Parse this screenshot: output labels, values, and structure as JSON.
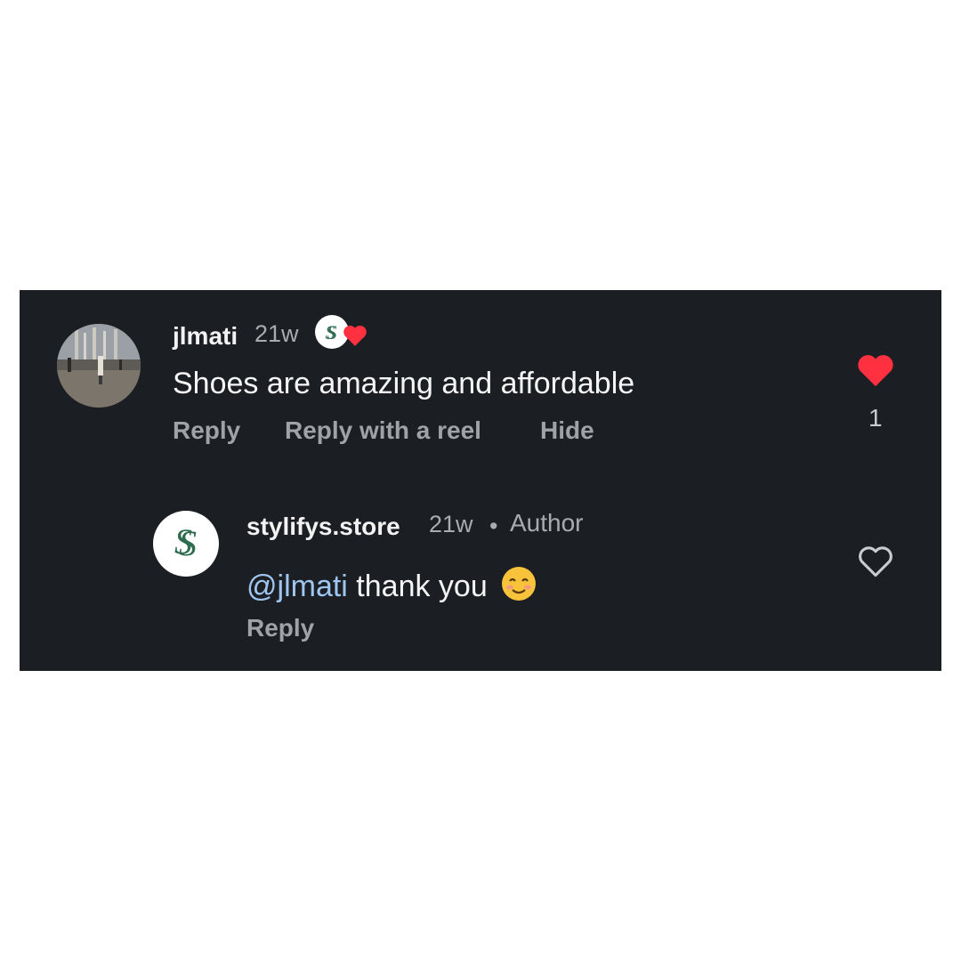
{
  "comment": {
    "username": "jlmati",
    "time": "21w",
    "text": "Shoes are amazing and affordable",
    "actions": {
      "reply": "Reply",
      "reply_reel": "Reply with a reel",
      "hide": "Hide"
    },
    "like_count": "1",
    "liked": true,
    "liked_by_author_icon": "heart-icon"
  },
  "reply": {
    "username": "stylifys.store",
    "time": "21w",
    "separator": "•",
    "author_label": "Author",
    "mention": "@jlmati",
    "text": " thank you",
    "emoji": "☺️",
    "actions": {
      "reply": "Reply"
    },
    "liked": false
  },
  "colors": {
    "background": "#1b1e22",
    "like_red": "#ff3040",
    "mention_blue": "#9fc6f0",
    "logo_green": "#2f6b4f"
  }
}
